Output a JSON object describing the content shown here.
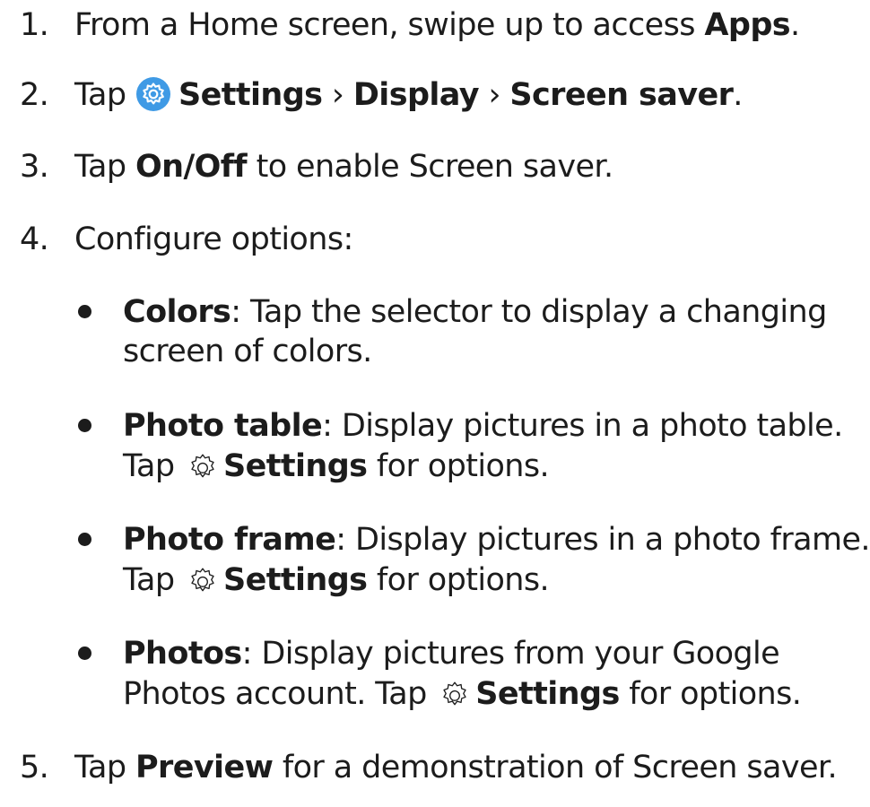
{
  "steps": [
    {
      "num": "1.",
      "pre": "From a Home screen, swipe up to access ",
      "b1": "Apps",
      "post": "."
    },
    {
      "num": "2.",
      "pre": "Tap ",
      "icon": "settings-app-icon",
      "b1": "Settings",
      "sep1": " › ",
      "b2": "Display",
      "sep2": " › ",
      "b3": "Screen saver",
      "post": "."
    },
    {
      "num": "3.",
      "pre": "Tap ",
      "b1": "On/Off",
      "post": " to enable Screen saver."
    },
    {
      "num": "4.",
      "text": "Configure options:"
    },
    {
      "num": "5.",
      "pre": "Tap ",
      "b1": "Preview",
      "post": " for a demonstration of Screen saver."
    }
  ],
  "options": [
    {
      "title": "Colors",
      "line1": ": Tap the selector to display a changing",
      "line2": "screen of colors."
    },
    {
      "title": "Photo table",
      "line1": ": Display pictures in a photo table.",
      "line2_pre": "Tap ",
      "icon": "settings-gear-icon",
      "line2_b": "Settings",
      "line2_post": " for options."
    },
    {
      "title": "Photo frame",
      "line1": ": Display pictures in a photo frame.",
      "line2_pre": "Tap ",
      "icon": "settings-gear-icon",
      "line2_b": "Settings",
      "line2_post": " for options."
    },
    {
      "title": "Photos",
      "line1": ": Display pictures from your Google",
      "line2_pre": "Photos account. Tap ",
      "icon": "settings-gear-icon",
      "line2_b": "Settings",
      "line2_post": " for options."
    }
  ],
  "colors": {
    "text": "#1c1c1c",
    "settings_icon_bg": "#3f9ae5"
  }
}
